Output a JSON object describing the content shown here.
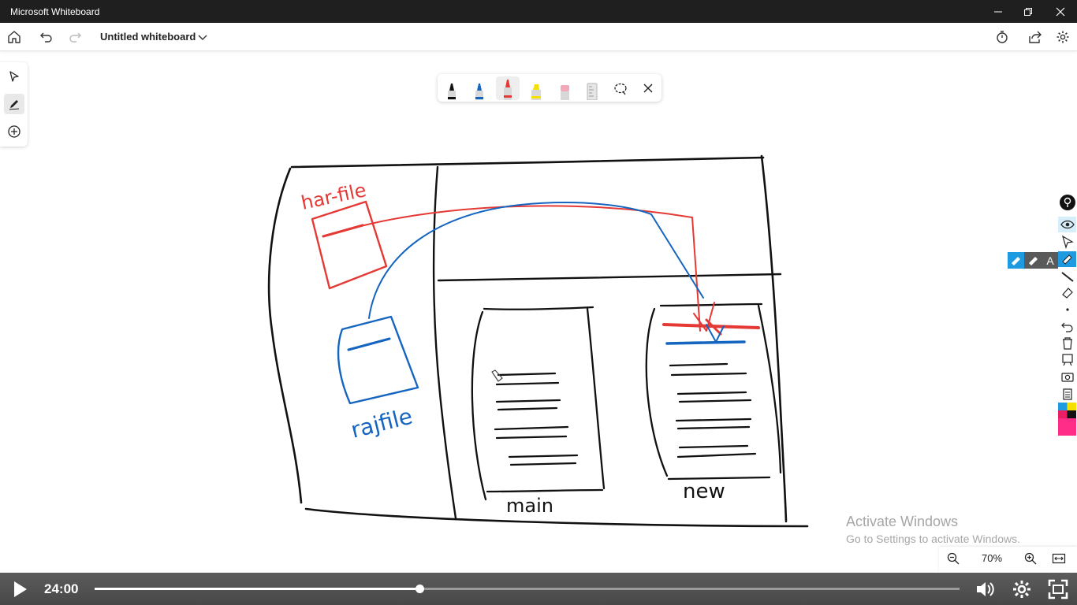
{
  "window": {
    "title": "Microsoft Whiteboard",
    "minimize_icon": "minimize-icon",
    "restore_icon": "restore-icon",
    "close_icon": "close-icon"
  },
  "toolbar": {
    "board_title": "Untitled whiteboard",
    "icons": [
      "home-icon",
      "undo-icon",
      "redo-icon",
      "chevron-down-icon",
      "timer-icon",
      "share-icon",
      "gear-icon"
    ]
  },
  "left_rail": {
    "items": [
      {
        "name": "select-tool",
        "icon": "arrow-pointer-icon"
      },
      {
        "name": "pen-tool",
        "icon": "pen-icon",
        "active": true
      },
      {
        "name": "add-tool",
        "icon": "plus-circle-icon"
      }
    ]
  },
  "pen_tray": {
    "pens": [
      {
        "name": "black-pen",
        "color": "#111111"
      },
      {
        "name": "blue-pen",
        "color": "#1565c0"
      },
      {
        "name": "red-pen",
        "color": "#e53935",
        "active": true
      },
      {
        "name": "yellow-highlighter",
        "color": "#f5e000"
      },
      {
        "name": "eraser",
        "color": "#f3a8b8"
      },
      {
        "name": "ruler",
        "color": "#c8c8c8"
      }
    ],
    "lasso_icon": "lasso-icon",
    "close_icon": "close-icon"
  },
  "drawing": {
    "labels": [
      {
        "text": "har-file",
        "color": "#e53935"
      },
      {
        "text": "rajfile",
        "color": "#1565c0"
      },
      {
        "text": "main",
        "color": "#111111"
      },
      {
        "text": "new",
        "color": "#111111"
      }
    ],
    "colors": {
      "ink_black": "#111111",
      "ink_red": "#e53935",
      "ink_blue": "#1565c0"
    }
  },
  "right_dock": {
    "icons": [
      "pin-icon",
      "eye-icon",
      "cursor-icon",
      "highlighter-icon",
      "line-icon",
      "eraser-icon",
      "dot-icon",
      "undo-icon",
      "trash-icon",
      "board-icon",
      "camera-icon",
      "clipboard-icon",
      "color-swatch-icon"
    ],
    "float_icons": [
      "highlighter-icon",
      "eraser-icon",
      "text-icon",
      "highlighter-icon"
    ],
    "float_text": "A"
  },
  "watermark": {
    "line1": "Activate Windows",
    "line2": "Go to Settings to activate Windows."
  },
  "zoom": {
    "level": "70%",
    "zoom_out_icon": "zoom-out-icon",
    "zoom_in_icon": "zoom-in-icon",
    "fit_icon": "fit-width-icon"
  },
  "video_player": {
    "time": "24:00",
    "progress": 0.376,
    "icons": [
      "play-icon",
      "volume-icon",
      "settings-icon",
      "fullscreen-icon"
    ]
  }
}
